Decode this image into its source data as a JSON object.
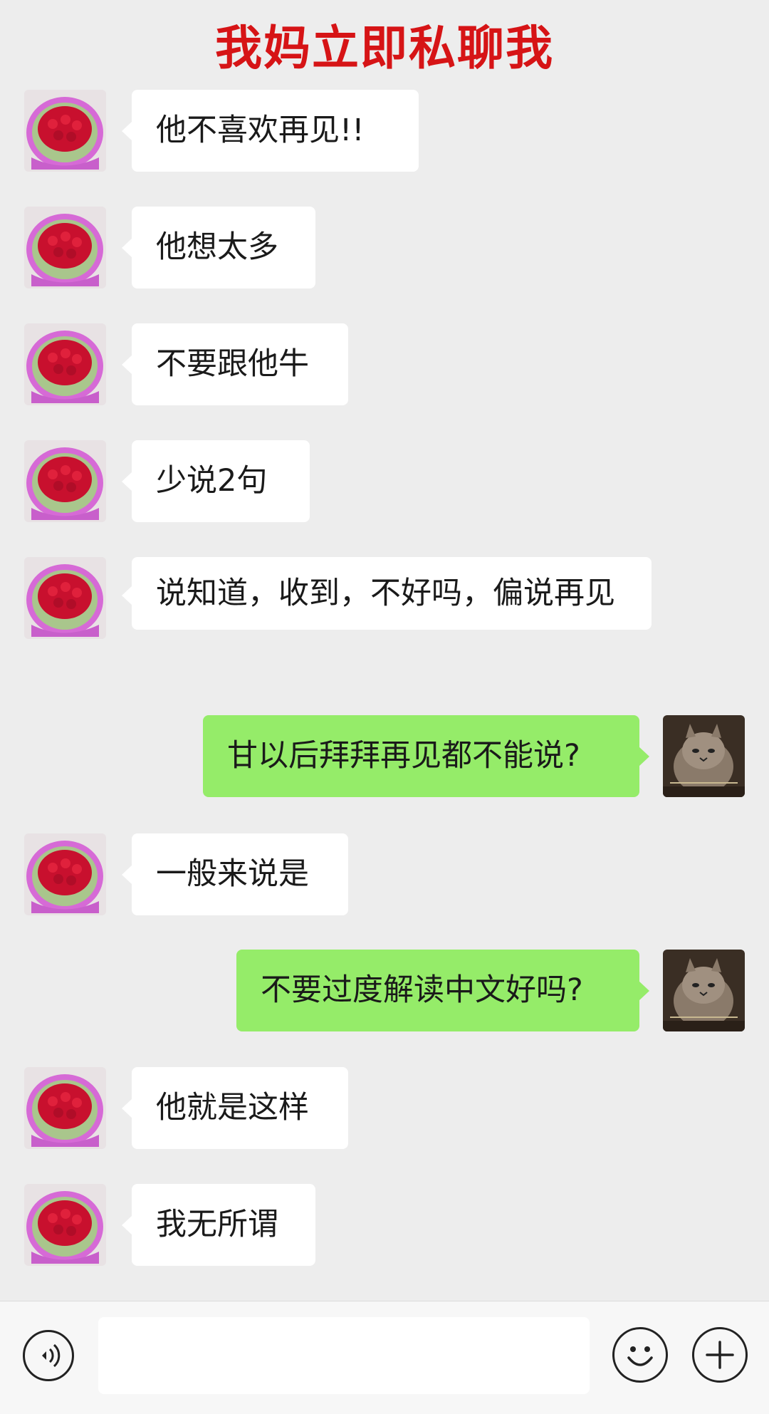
{
  "overlay_title": "我妈立即私聊我",
  "colors": {
    "background": "#ededed",
    "incoming_bubble": "#ffffff",
    "outgoing_bubble": "#95ec69",
    "title_red": "#d61416"
  },
  "messages": [
    {
      "side": "in",
      "avatar": "rose-bouquet-avatar",
      "text": "他不喜欢再见!!"
    },
    {
      "side": "in",
      "avatar": "rose-bouquet-avatar",
      "text": "他想太多"
    },
    {
      "side": "in",
      "avatar": "rose-bouquet-avatar",
      "text": "不要跟他牛"
    },
    {
      "side": "in",
      "avatar": "rose-bouquet-avatar",
      "text": "少说2句"
    },
    {
      "side": "in",
      "avatar": "rose-bouquet-avatar",
      "text": "说知道，收到，不好吗，偏说再见"
    },
    {
      "side": "out",
      "avatar": "cat-avatar",
      "text": "甘以后拜拜再见都不能说?"
    },
    {
      "side": "in",
      "avatar": "rose-bouquet-avatar",
      "text": "一般来说是"
    },
    {
      "side": "out",
      "avatar": "cat-avatar",
      "text": "不要过度解读中文好吗?"
    },
    {
      "side": "in",
      "avatar": "rose-bouquet-avatar",
      "text": "他就是这样"
    },
    {
      "side": "in",
      "avatar": "rose-bouquet-avatar",
      "text": "我无所谓"
    }
  ],
  "input_bar": {
    "voice_icon": "voice-icon",
    "input_value": "",
    "emoji_icon": "emoji-icon",
    "plus_icon": "plus-icon"
  }
}
